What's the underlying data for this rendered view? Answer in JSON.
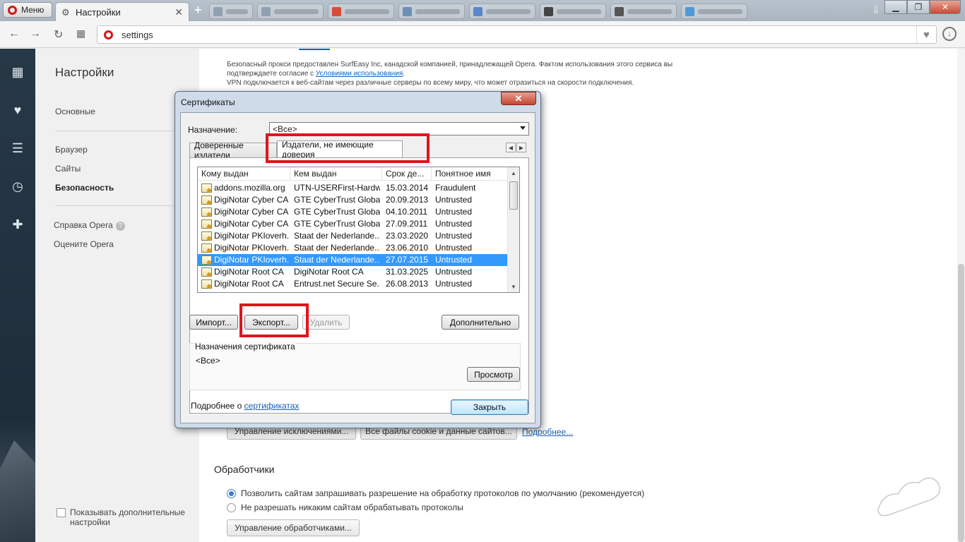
{
  "browser": {
    "menu_label": "Меню",
    "active_tab_title": "Настройки",
    "new_tab_symbol": "+",
    "url": "settings",
    "background_tab_favicon_colors": [
      "#8fa0b0",
      "#8fa0b0",
      "#d94a3a",
      "#6c8fb5",
      "#5b86c8",
      "#444444",
      "#555555",
      "#4c9ad8"
    ],
    "window_controls": {
      "minimize": "▁",
      "maximize": "❐",
      "close": "✕"
    }
  },
  "sidebar_icons": [
    "speed-dial-icon",
    "heart-icon",
    "news-icon",
    "history-icon",
    "extensions-icon"
  ],
  "settings_nav": {
    "title": "Настройки",
    "items": [
      {
        "label": "Основные"
      },
      {
        "label": "Браузер"
      },
      {
        "label": "Сайты"
      },
      {
        "label": "Безопасность"
      }
    ],
    "help_label": "Справка Opera",
    "rate_label": "Оцените Opera",
    "show_advanced_label_1": "Показывать дополнительные",
    "show_advanced_label_2": "настройки"
  },
  "main": {
    "proxy_line1": "Безопасный прокси предоставлен SurfEasy Inc, канадской компанией, принадлежащей Opera. Фактом использования этого сервиса вы",
    "proxy_line2_prefix": "подтверждаете согласие с ",
    "proxy_terms_link": "Условиями использования",
    "proxy_line2_suffix": ".",
    "proxy_line3": "VPN подключается к веб-сайтам через различные серверы по всему миру, что может отразиться на скорости подключения.",
    "manage_exceptions_btn": "Управление исключениями...",
    "all_cookies_btn": "Все файлы cookie и данные сайтов...",
    "more_link": "Подробнее...",
    "handlers_heading": "Обработчики",
    "radio_allow": "Позволить сайтам запрашивать разрешение на обработку протоколов по умолчанию (рекомендуется)",
    "radio_deny": "Не разрешать никаким сайтам обрабатывать протоколы",
    "manage_handlers_btn": "Управление обработчиками..."
  },
  "dialog": {
    "title": "Сертификаты",
    "close_symbol": "✕",
    "purpose_label": "Назначение:",
    "purpose_value": "<Все>",
    "tabs": [
      "Доверенные издатели",
      "Издатели, не имеющие доверия"
    ],
    "columns": [
      "Кому выдан",
      "Кем выдан",
      "Срок де...",
      "Понятное имя"
    ],
    "rows": [
      [
        "addons.mozilla.org",
        "UTN-USERFirst-Hardw...",
        "15.03.2014",
        "Fraudulent"
      ],
      [
        "DigiNotar Cyber CA",
        "GTE CyberTrust Globa...",
        "20.09.2013",
        "Untrusted"
      ],
      [
        "DigiNotar Cyber CA",
        "GTE CyberTrust Globa...",
        "04.10.2011",
        "Untrusted"
      ],
      [
        "DigiNotar Cyber CA",
        "GTE CyberTrust Globa...",
        "27.09.2011",
        "Untrusted"
      ],
      [
        "DigiNotar PKIoverh...",
        "Staat der Nederlande...",
        "23.03.2020",
        "Untrusted"
      ],
      [
        "DigiNotar PKIoverh...",
        "Staat der Nederlande...",
        "23.06.2010",
        "Untrusted"
      ],
      [
        "DigiNotar PKIoverh...",
        "Staat der Nederlande...",
        "27.07.2015",
        "Untrusted"
      ],
      [
        "DigiNotar Root CA",
        "DigiNotar Root CA",
        "31.03.2025",
        "Untrusted"
      ],
      [
        "DigiNotar Root CA",
        "Entrust.net Secure Se...",
        "26.08.2013",
        "Untrusted"
      ]
    ],
    "selected_row": 6,
    "import_btn": "Импорт...",
    "export_btn": "Экспорт...",
    "delete_btn": "Удалить",
    "advanced_btn": "Дополнительно",
    "cert_purposes_label": "Назначения сертификата",
    "cert_purposes_value": "<Все>",
    "view_btn": "Просмотр",
    "more_prefix": "Подробнее о ",
    "more_link": "сертификатах",
    "close_btn": "Закрыть"
  },
  "colors": {
    "highlight_red": "#e0141c",
    "selection_blue": "#3399ff",
    "link_blue": "#1a5fb4",
    "sidebar_dark": "#223241"
  }
}
